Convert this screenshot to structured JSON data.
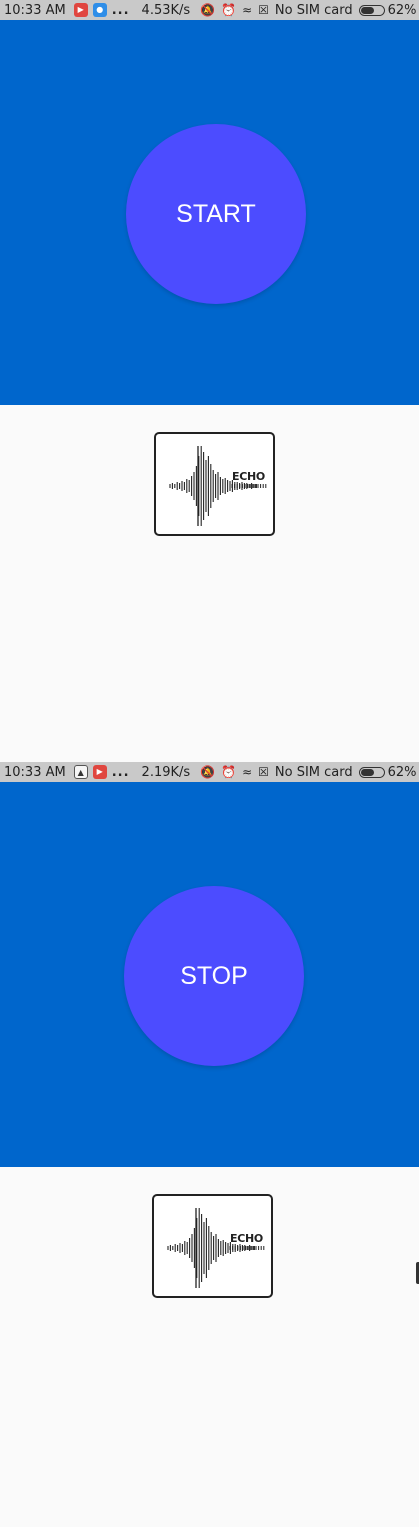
{
  "screens": [
    {
      "status_bar": {
        "time": "10:33 AM",
        "app_icons": [
          "video-camera-icon",
          "messenger-icon"
        ],
        "overflow": "...",
        "net_speed": "4.53K/s",
        "carrier": "No SIM card",
        "battery": "62%",
        "battery_level": 0.62
      },
      "button_label": "START",
      "logo_text": "ECHO"
    },
    {
      "status_bar": {
        "time": "10:33 AM",
        "app_icons": [
          "photo-icon",
          "video-camera-icon"
        ],
        "overflow": "...",
        "net_speed": "2.19K/s",
        "carrier": "No SIM card",
        "battery": "62%",
        "battery_level": 0.62
      },
      "button_label": "STOP",
      "logo_text": "ECHO"
    }
  ],
  "colors": {
    "status_bar": "#c9c9c9",
    "hero_background": "#0066cc",
    "button": "#4c4cff",
    "button_text": "#ffffff",
    "page_background": "#fafafa"
  },
  "status_icons": [
    "mute-icon",
    "alarm-icon",
    "wifi-icon",
    "no-sim-icon",
    "battery-icon"
  ]
}
